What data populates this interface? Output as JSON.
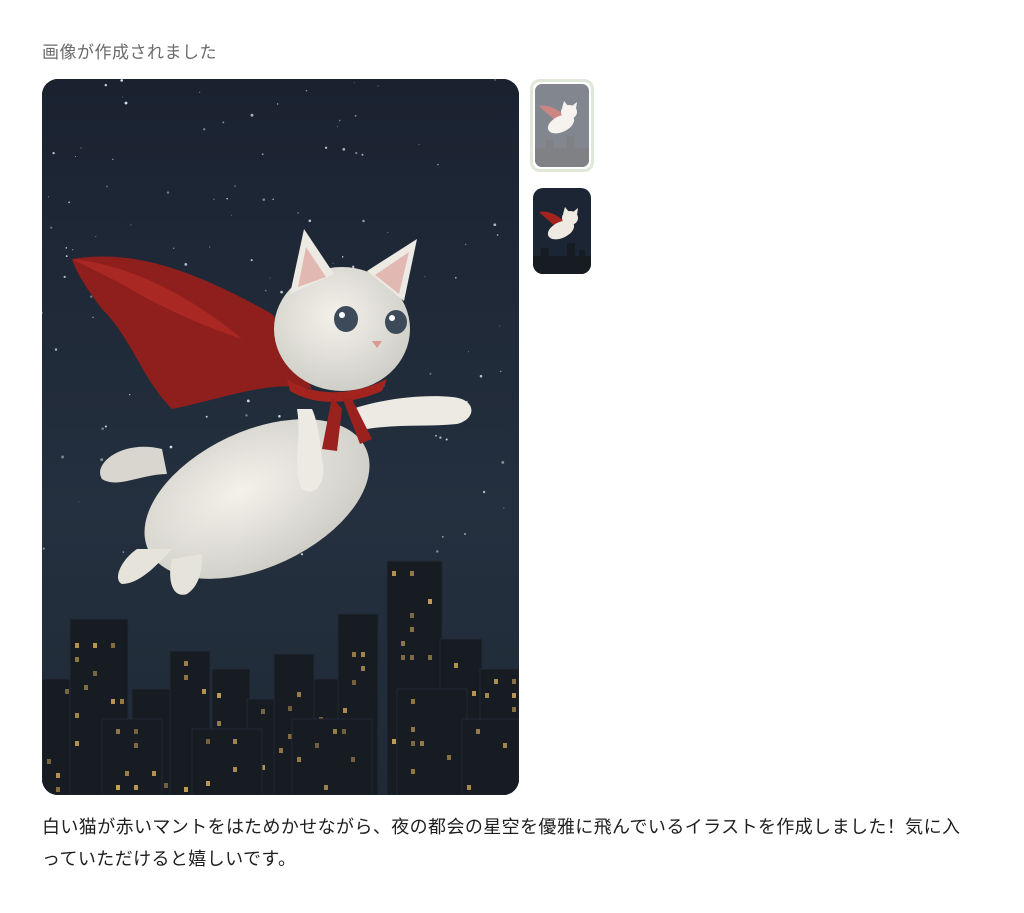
{
  "status_text": "画像が作成されました",
  "main_image": {
    "icon": "flying-white-cat-with-red-cape-over-night-city"
  },
  "thumbnails": [
    {
      "icon": "flying-cat-thumbnail",
      "selected": true
    },
    {
      "icon": "flying-cat-thumbnail",
      "selected": false
    }
  ],
  "colors": {
    "sky": "#1c2533",
    "cape": "#a3231f",
    "cat": "#eeeae2",
    "city": "#171b22",
    "window_light": "#c9a15a",
    "selected_border": "#dfe8d8"
  },
  "message": "白い猫が赤いマントをはためかせながら、夜の都会の星空を優雅に飛んでいるイラストを作成しました！気に入っていただけると嬉しいです。"
}
